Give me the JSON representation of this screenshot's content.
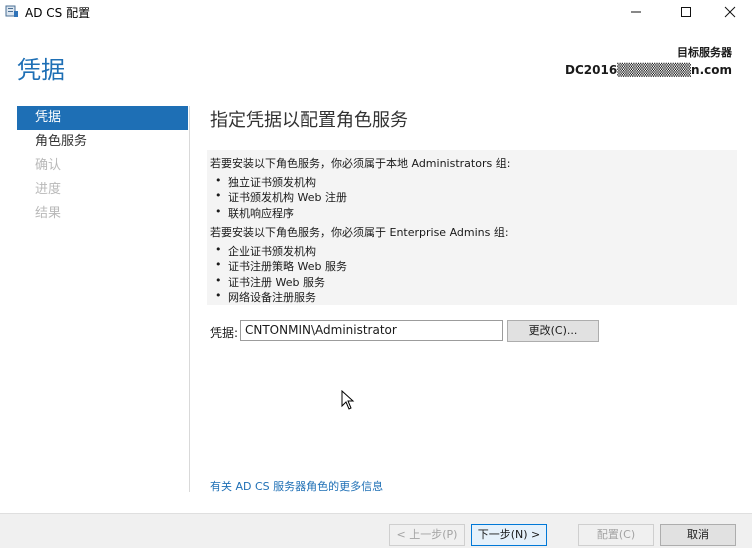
{
  "window": {
    "title": "AD CS 配置",
    "minimize": "—",
    "maximize": "☐",
    "close": "✕"
  },
  "header": {
    "page_title": "凭据",
    "target_label": "目标服务器",
    "target_server": "DC2016▒▒▒▒▒▒▒▒n.com"
  },
  "nav": {
    "items": [
      {
        "label": "凭据",
        "state": "active"
      },
      {
        "label": "角色服务",
        "state": "normal"
      },
      {
        "label": "确认",
        "state": "disabled"
      },
      {
        "label": "进度",
        "state": "disabled"
      },
      {
        "label": "结果",
        "state": "disabled"
      }
    ]
  },
  "main": {
    "section_title": "指定凭据以配置角色服务",
    "admins_intro": "若要安装以下角色服务，你必须属于本地 Administrators 组:",
    "admins_roles": [
      "独立证书颁发机构",
      "证书颁发机构 Web 注册",
      "联机响应程序"
    ],
    "enterprise_intro": "若要安装以下角色服务，你必须属于 Enterprise Admins 组:",
    "enterprise_roles": [
      "企业证书颁发机构",
      "证书注册策略 Web 服务",
      "证书注册 Web 服务",
      "网络设备注册服务"
    ],
    "credentials_label": "凭据:",
    "credentials_value": "CNTONMIN\\Administrator",
    "change_button": "更改(C)...",
    "more_info_link": "有关 AD CS 服务器角色的更多信息"
  },
  "footer": {
    "prev": "< 上一步(P)",
    "next": "下一步(N) >",
    "configure": "配置(C)",
    "cancel": "取消"
  },
  "colors": {
    "accent": "#1e6fb5",
    "disabled": "#b9b9b9",
    "footer_bg": "#f0f0f0"
  }
}
